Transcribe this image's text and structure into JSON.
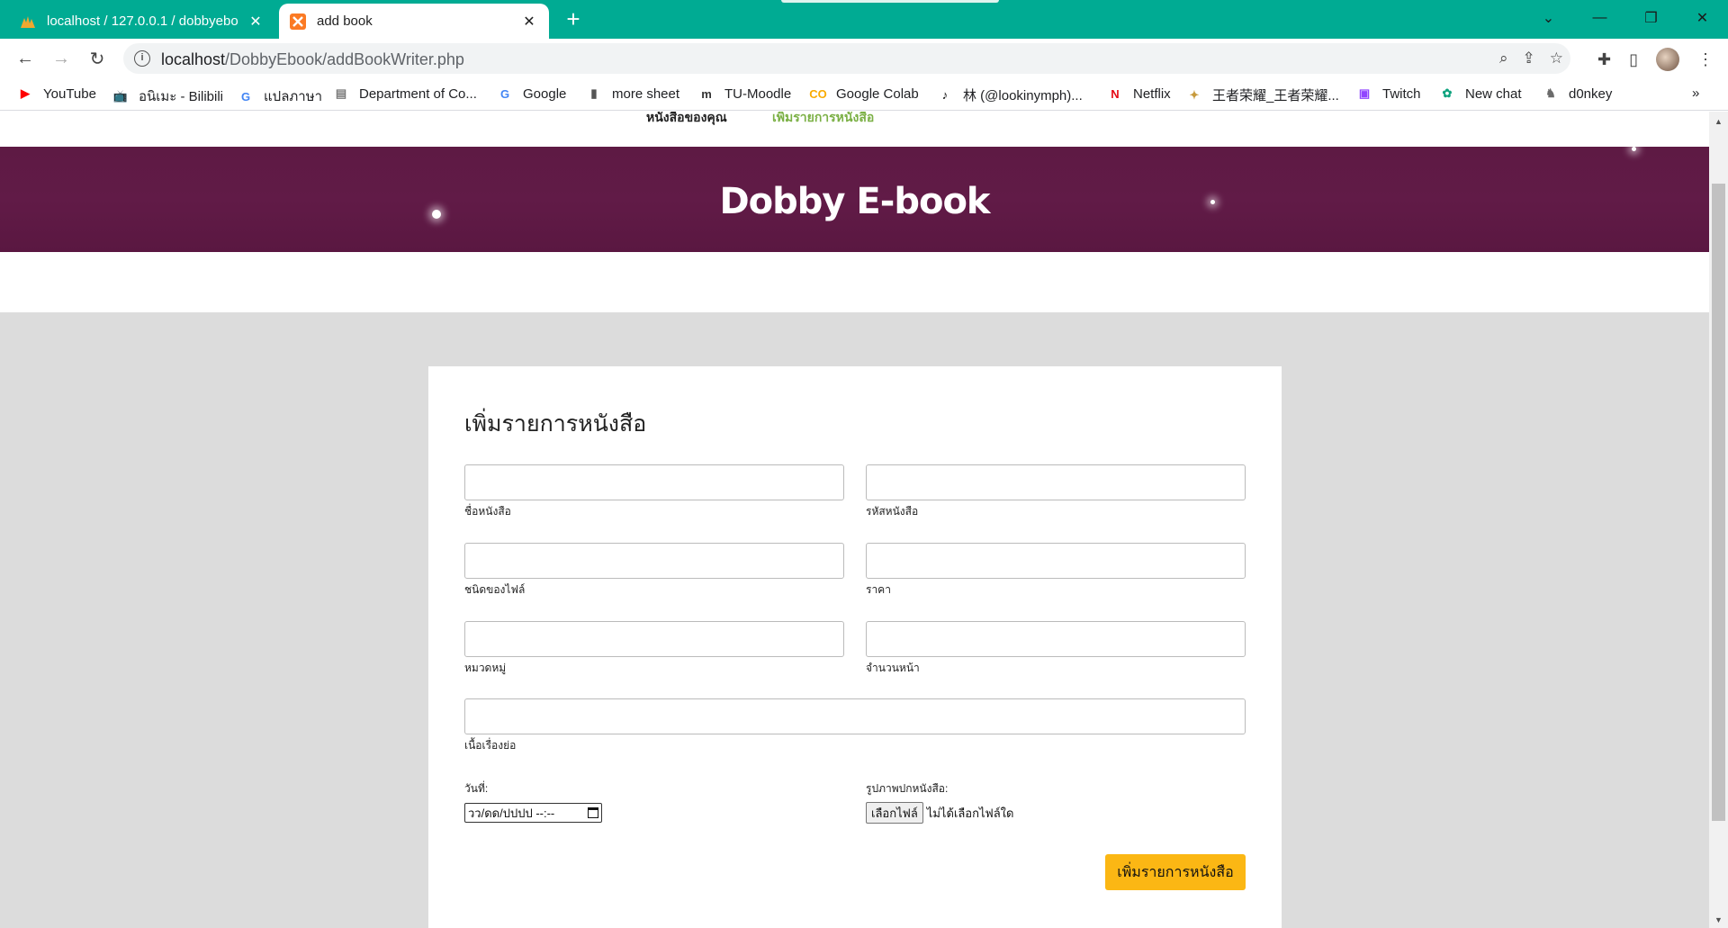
{
  "browser": {
    "tabs": [
      {
        "title": "localhost / 127.0.0.1 / dobbyebo",
        "active": false
      },
      {
        "title": "add book",
        "active": true
      }
    ],
    "url_host": "localhost",
    "url_path": "/DobbyEbook/addBookWriter.php",
    "bookmarks": [
      {
        "label": "YouTube",
        "icon": "youtube-icon",
        "color": "#ff0000"
      },
      {
        "label": "อนิเมะ - Bilibili",
        "icon": "bilibili-icon",
        "color": "#00a1d6"
      },
      {
        "label": "แปลภาษา",
        "icon": "translate-icon",
        "color": "#4285f4"
      },
      {
        "label": "Department of Co...",
        "icon": "department-icon",
        "color": "#7a7a7a"
      },
      {
        "label": "Google",
        "icon": "google-icon",
        "color": "#4285f4"
      },
      {
        "label": "more sheet",
        "icon": "sheet-icon",
        "color": "#555555"
      },
      {
        "label": "TU-Moodle",
        "icon": "moodle-icon",
        "color": "#333333"
      },
      {
        "label": "Google Colab",
        "icon": "colab-icon",
        "color": "#f9ab00"
      },
      {
        "label": "林 (@lookinymph)...",
        "icon": "tiktok-icon",
        "color": "#000000"
      },
      {
        "label": "Netflix",
        "icon": "netflix-icon",
        "color": "#e50914"
      },
      {
        "label": "王者荣耀_王者荣耀...",
        "icon": "game-icon",
        "color": "#c79a3c"
      },
      {
        "label": "Twitch",
        "icon": "twitch-icon",
        "color": "#9146ff"
      },
      {
        "label": "New chat",
        "icon": "openai-icon",
        "color": "#10a37f"
      },
      {
        "label": "d0nkey",
        "icon": "donkey-icon",
        "color": "#6b6b6b"
      }
    ],
    "more_bookmarks": "»"
  },
  "page": {
    "nav_links": [
      "หนังสือของคุณ",
      "เพิ่มรายการหนังสือ"
    ],
    "hero_title": "Dobby E-book",
    "form": {
      "heading": "เพิ่มรายการหนังสือ",
      "fields": {
        "book_name": {
          "label": "ชื่อหนังสือ",
          "value": ""
        },
        "book_code": {
          "label": "รหัสหนังสือ",
          "value": ""
        },
        "file_type": {
          "label": "ชนิดของไฟล์",
          "value": ""
        },
        "price": {
          "label": "ราคา",
          "value": ""
        },
        "category": {
          "label": "หมวดหมู่",
          "value": ""
        },
        "pages": {
          "label": "จำนวนหน้า",
          "value": ""
        },
        "synopsis": {
          "label": "เนื้อเรื่องย่อ",
          "value": ""
        }
      },
      "date_label": "วันที่:",
      "date_placeholder": "วว/ดด/ปปปป --:--",
      "cover_label": "รูปภาพปกหนังสือ:",
      "file_button": "เลือกไฟล์",
      "file_status": "ไม่ได้เลือกไฟล์ใด",
      "submit_label": "เพิ่มรายการหนังสือ"
    },
    "colors": {
      "hero_bg": "#5e1a44",
      "browser_accent": "#00ab93",
      "submit_bg": "#fbb714",
      "page_bg": "#dcdcdc"
    }
  }
}
